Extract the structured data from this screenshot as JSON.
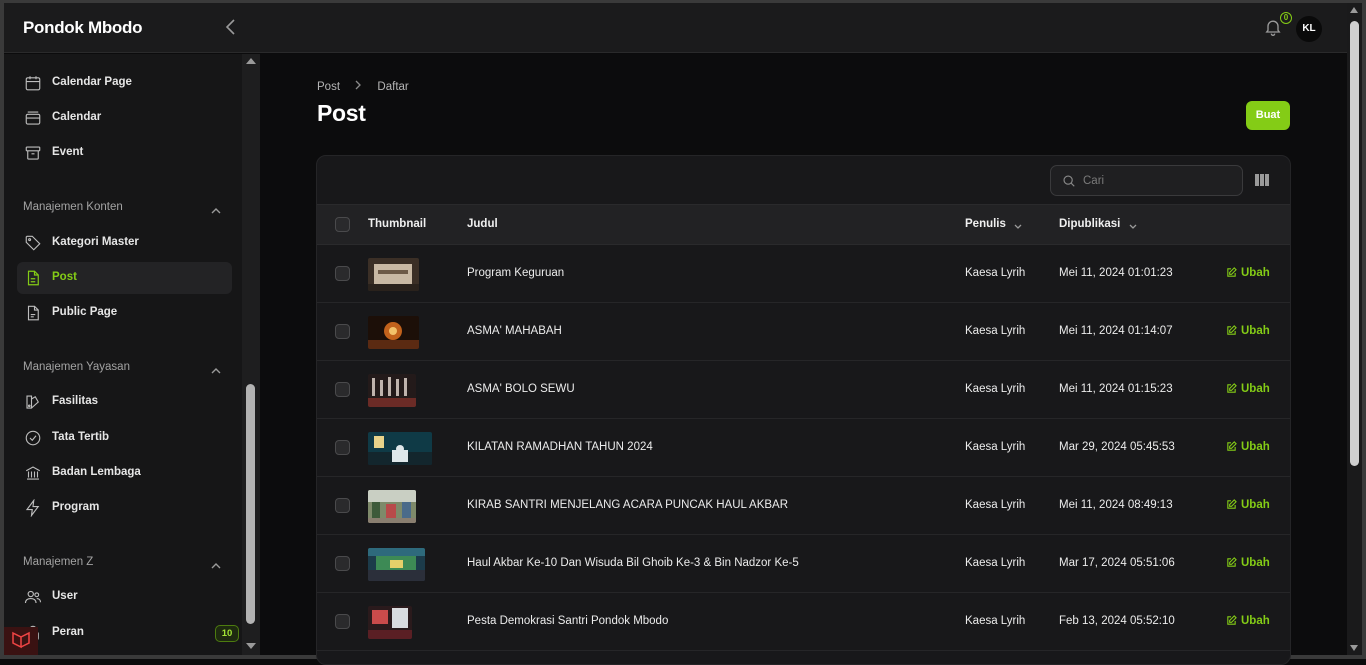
{
  "app": {
    "brand": "Pondok Mbodo",
    "notifications_count": "0",
    "user_initials": "KL"
  },
  "sidebar": {
    "top_items": [
      {
        "label": "Calendar Page",
        "icon": "calendar-icon"
      },
      {
        "label": "Calendar",
        "icon": "inbox-stack-icon"
      },
      {
        "label": "Event",
        "icon": "archive-box-icon"
      }
    ],
    "groups": [
      {
        "label": "Manajemen Konten",
        "items": [
          {
            "label": "Kategori Master",
            "icon": "tag-icon"
          },
          {
            "label": "Post",
            "icon": "document-text-icon",
            "active": true
          },
          {
            "label": "Public Page",
            "icon": "document-icon"
          }
        ]
      },
      {
        "label": "Manajemen Yayasan",
        "items": [
          {
            "label": "Fasilitas",
            "icon": "swatch-icon"
          },
          {
            "label": "Tata Tertib",
            "icon": "check-circle-icon"
          },
          {
            "label": "Badan Lembaga",
            "icon": "building-library-icon"
          },
          {
            "label": "Program",
            "icon": "bolt-icon"
          }
        ]
      },
      {
        "label": "Manajemen Z",
        "items": [
          {
            "label": "User",
            "icon": "users-icon"
          },
          {
            "label": "Peran",
            "icon": "lock-icon",
            "badge": "10"
          }
        ]
      }
    ]
  },
  "breadcrumb": {
    "items": [
      "Post",
      "Daftar"
    ]
  },
  "page": {
    "title": "Post",
    "create_label": "Buat"
  },
  "search": {
    "placeholder": "Cari"
  },
  "table": {
    "columns": {
      "thumbnail": "Thumbnail",
      "judul": "Judul",
      "penulis": "Penulis",
      "dipublikasi": "Dipublikasi"
    },
    "edit_label": "Ubah",
    "rows": [
      {
        "judul": "Program Keguruan",
        "penulis": "Kaesa Lyrih",
        "dipublikasi": "Mei 11, 2024 01:01:23"
      },
      {
        "judul": "ASMA' MAHABAH",
        "penulis": "Kaesa Lyrih",
        "dipublikasi": "Mei 11, 2024 01:14:07"
      },
      {
        "judul": "ASMA' BOLO SEWU",
        "penulis": "Kaesa Lyrih",
        "dipublikasi": "Mei 11, 2024 01:15:23"
      },
      {
        "judul": "KILATAN RAMADHAN TAHUN 2024",
        "penulis": "Kaesa Lyrih",
        "dipublikasi": "Mar 29, 2024 05:45:53"
      },
      {
        "judul": "KIRAB SANTRI MENJELANG ACARA PUNCAK HAUL AKBAR",
        "penulis": "Kaesa Lyrih",
        "dipublikasi": "Mei 11, 2024 08:49:13"
      },
      {
        "judul": "Haul Akbar Ke-10 Dan Wisuda Bil Ghoib Ke-3 & Bin Nadzor Ke-5",
        "penulis": "Kaesa Lyrih",
        "dipublikasi": "Mar 17, 2024 05:51:06"
      },
      {
        "judul": "Pesta Demokrasi Santri Pondok Mbodo",
        "penulis": "Kaesa Lyrih",
        "dipublikasi": "Feb 13, 2024 05:52:10"
      }
    ]
  },
  "colors": {
    "accent": "#84cc16",
    "background": "#0c0c0d",
    "sidebar": "#161617"
  }
}
